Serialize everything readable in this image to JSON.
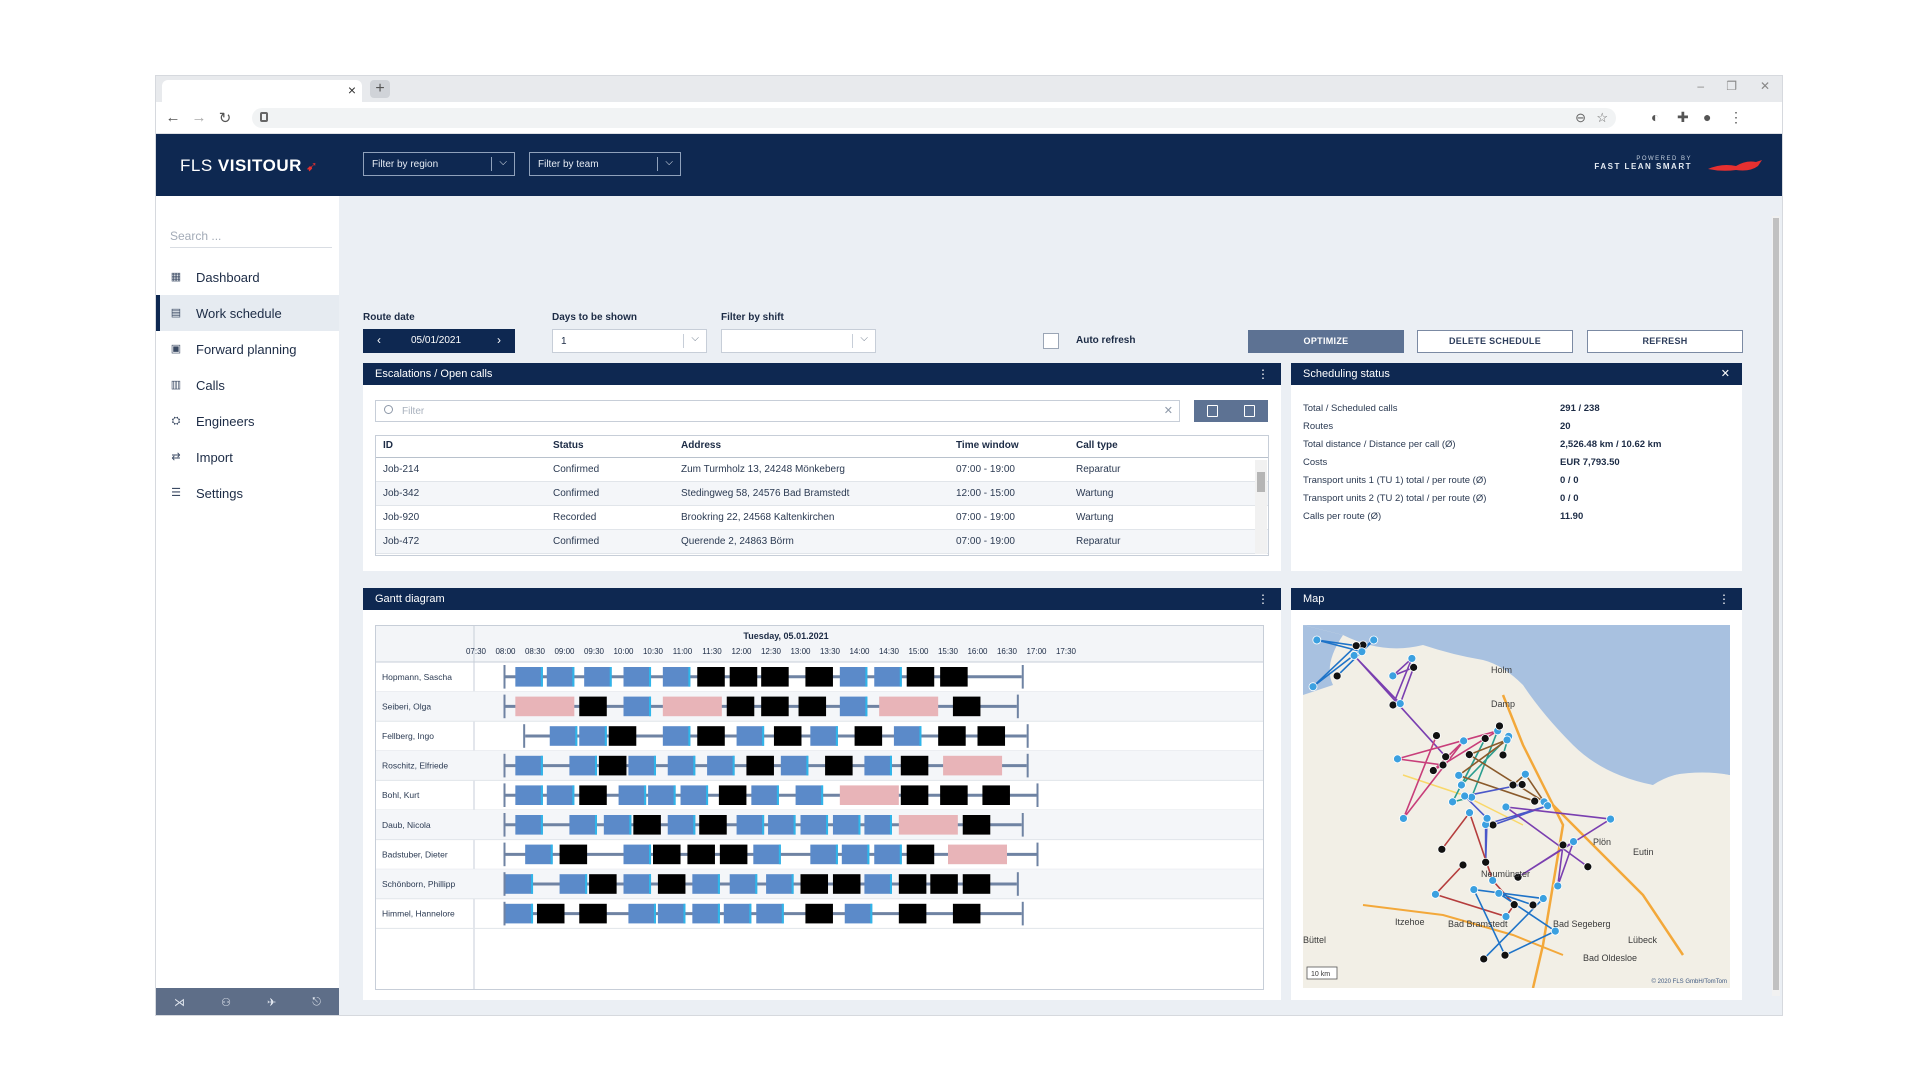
{
  "browser": {
    "newtab_label": "+",
    "close_tab": "×",
    "win_min": "–",
    "win_max": "❐",
    "win_close": "✕"
  },
  "header": {
    "logo_light": "FLS ",
    "logo_bold": "VISITOUR",
    "region_placeholder": "Filter by region",
    "team_placeholder": "Filter by team",
    "powered_by": "POWERED BY",
    "brand": "FAST LEAN SMART",
    "accent": "#e63030"
  },
  "sidebar": {
    "search_placeholder": "Search ...",
    "items": [
      {
        "label": "Dashboard",
        "icon": "dashboard-icon"
      },
      {
        "label": "Work schedule",
        "icon": "calendar-icon"
      },
      {
        "label": "Forward planning",
        "icon": "calendar-forward-icon"
      },
      {
        "label": "Calls",
        "icon": "calls-icon"
      },
      {
        "label": "Engineers",
        "icon": "engineers-icon"
      },
      {
        "label": "Import",
        "icon": "import-icon"
      },
      {
        "label": "Settings",
        "icon": "settings-icon"
      }
    ],
    "active_item": "Work schedule"
  },
  "toolbar": {
    "route_date_label": "Route date",
    "route_date": "05/01/2021",
    "days_label": "Days to be shown",
    "days_value": "1",
    "shift_label": "Filter by shift",
    "shift_value": "",
    "auto_refresh_label": "Auto refresh",
    "auto_refresh_checked": false,
    "optimize": "OPTIMIZE",
    "delete_schedule": "DELETE SCHEDULE",
    "refresh": "REFRESH"
  },
  "escalations": {
    "title": "Escalations / Open calls",
    "filter_placeholder": "Filter",
    "columns": [
      "ID",
      "Status",
      "Address",
      "Time window",
      "Call type"
    ],
    "rows": [
      [
        "Job-214",
        "Confirmed",
        "Zum Turmholz 13, 24248 Mönkeberg",
        "07:00 - 19:00",
        "Reparatur"
      ],
      [
        "Job-342",
        "Confirmed",
        "Stedingweg 58, 24576 Bad Bramstedt",
        "12:00 - 15:00",
        "Wartung"
      ],
      [
        "Job-920",
        "Recorded",
        "Brookring 22, 24568 Kaltenkirchen",
        "07:00 - 19:00",
        "Wartung"
      ],
      [
        "Job-472",
        "Confirmed",
        "Querende 2, 24863 Börm",
        "07:00 - 19:00",
        "Reparatur"
      ]
    ]
  },
  "scheduling_status": {
    "title": "Scheduling status",
    "rows": [
      {
        "label": "Total / Scheduled calls",
        "value": "291 / 238"
      },
      {
        "label": "Routes",
        "value": "20"
      },
      {
        "label": "Total distance / Distance per call (Ø)",
        "value": "2,526.48 km / 10.62 km"
      },
      {
        "label": "Costs",
        "value": "EUR 7,793.50"
      },
      {
        "label": "Transport units 1 (TU 1) total / per route (Ø)",
        "value": "0 / 0"
      },
      {
        "label": "Transport units 2 (TU 2) total / per route (Ø)",
        "value": "0 / 0"
      },
      {
        "label": "Calls per route (Ø)",
        "value": "11.90"
      }
    ]
  },
  "gantt": {
    "title": "Gantt diagram",
    "date_label": "Tuesday, 05.01.2021",
    "times": [
      "07:30",
      "08:00",
      "08:30",
      "09:00",
      "09:30",
      "10:00",
      "10:30",
      "11:00",
      "11:30",
      "12:00",
      "12:30",
      "13:00",
      "13:30",
      "14:00",
      "14:30",
      "15:00",
      "15:30",
      "16:00",
      "16:30",
      "17:00",
      "17:30"
    ],
    "colors": {
      "call": "#5b8ac9",
      "fixed": "#000000",
      "break": "#e8b4b8",
      "route": "#6f83a3",
      "overtime": "#f3c47a"
    },
    "engineers": [
      {
        "name": "Hopmann, Sascha",
        "start": "08:00",
        "end": "16:45",
        "tasks": [
          [
            "call",
            "08:10",
            "08:38"
          ],
          [
            "call",
            "08:42",
            "09:10"
          ],
          [
            "call",
            "09:20",
            "09:48"
          ],
          [
            "call",
            "10:00",
            "10:28"
          ],
          [
            "call",
            "10:40",
            "11:08"
          ],
          [
            "fixed",
            "11:15",
            "11:43"
          ],
          [
            "fixed",
            "11:48",
            "12:16"
          ],
          [
            "fixed",
            "12:20",
            "12:48"
          ],
          [
            "fixed",
            "13:05",
            "13:33"
          ],
          [
            "call",
            "13:40",
            "14:08"
          ],
          [
            "call",
            "14:15",
            "14:43"
          ],
          [
            "fixed",
            "14:48",
            "15:16"
          ],
          [
            "fixed",
            "15:22",
            "15:50"
          ]
        ]
      },
      {
        "name": "Seiberi, Olga",
        "start": "08:00",
        "end": "16:40",
        "tasks": [
          [
            "break",
            "08:10",
            "09:10"
          ],
          [
            "fixed",
            "09:15",
            "09:43"
          ],
          [
            "call",
            "10:00",
            "10:28"
          ],
          [
            "break",
            "10:40",
            "11:40"
          ],
          [
            "fixed",
            "11:45",
            "12:13"
          ],
          [
            "fixed",
            "12:20",
            "12:48"
          ],
          [
            "fixed",
            "12:58",
            "13:26"
          ],
          [
            "call",
            "13:40",
            "14:08"
          ],
          [
            "break",
            "14:20",
            "15:20"
          ],
          [
            "fixed",
            "15:35",
            "16:03"
          ]
        ]
      },
      {
        "name": "Fellberg, Ingo",
        "start": "08:20",
        "end": "16:50",
        "tasks": [
          [
            "call",
            "08:45",
            "09:13"
          ],
          [
            "call",
            "09:15",
            "09:43"
          ],
          [
            "fixed",
            "09:45",
            "10:13"
          ],
          [
            "call",
            "10:40",
            "11:08"
          ],
          [
            "fixed",
            "11:15",
            "11:43"
          ],
          [
            "call",
            "11:55",
            "12:23"
          ],
          [
            "fixed",
            "12:33",
            "13:01"
          ],
          [
            "call",
            "13:10",
            "13:38"
          ],
          [
            "fixed",
            "13:55",
            "14:23"
          ],
          [
            "call",
            "14:35",
            "15:03"
          ],
          [
            "fixed",
            "15:20",
            "15:48"
          ],
          [
            "fixed",
            "16:00",
            "16:28"
          ]
        ]
      },
      {
        "name": "Roschitz, Elfriede",
        "start": "08:00",
        "end": "16:50",
        "tasks": [
          [
            "call",
            "08:10",
            "08:38"
          ],
          [
            "call",
            "09:05",
            "09:33"
          ],
          [
            "fixed",
            "09:35",
            "10:03"
          ],
          [
            "call",
            "10:05",
            "10:33"
          ],
          [
            "call",
            "10:45",
            "11:13"
          ],
          [
            "call",
            "11:25",
            "11:53"
          ],
          [
            "fixed",
            "12:05",
            "12:33"
          ],
          [
            "call",
            "12:40",
            "13:08"
          ],
          [
            "fixed",
            "13:25",
            "13:53"
          ],
          [
            "call",
            "14:05",
            "14:33"
          ],
          [
            "fixed",
            "14:42",
            "15:10"
          ],
          [
            "break",
            "15:25",
            "16:25"
          ]
        ]
      },
      {
        "name": "Bohl, Kurt",
        "start": "08:00",
        "end": "17:00",
        "tasks": [
          [
            "call",
            "08:10",
            "08:38"
          ],
          [
            "call",
            "08:42",
            "09:10"
          ],
          [
            "fixed",
            "09:15",
            "09:43"
          ],
          [
            "call",
            "09:55",
            "10:23"
          ],
          [
            "call",
            "10:25",
            "10:53"
          ],
          [
            "call",
            "10:58",
            "11:26"
          ],
          [
            "fixed",
            "11:37",
            "12:05"
          ],
          [
            "call",
            "12:10",
            "12:38"
          ],
          [
            "call",
            "12:55",
            "13:23"
          ],
          [
            "break",
            "13:40",
            "14:40"
          ],
          [
            "fixed",
            "14:42",
            "15:10"
          ],
          [
            "fixed",
            "15:22",
            "15:50"
          ],
          [
            "fixed",
            "16:05",
            "16:33"
          ]
        ]
      },
      {
        "name": "Daub, Nicola",
        "start": "08:00",
        "end": "16:45",
        "tasks": [
          [
            "call",
            "08:10",
            "08:38"
          ],
          [
            "call",
            "09:05",
            "09:33"
          ],
          [
            "call",
            "09:40",
            "10:08"
          ],
          [
            "fixed",
            "10:10",
            "10:38"
          ],
          [
            "call",
            "10:45",
            "11:13"
          ],
          [
            "fixed",
            "11:17",
            "11:45"
          ],
          [
            "call",
            "11:55",
            "12:23"
          ],
          [
            "call",
            "12:27",
            "12:55"
          ],
          [
            "call",
            "13:00",
            "13:28"
          ],
          [
            "call",
            "13:33",
            "14:01"
          ],
          [
            "call",
            "14:05",
            "14:33"
          ],
          [
            "break",
            "14:40",
            "15:40"
          ],
          [
            "fixed",
            "15:45",
            "16:13"
          ]
        ]
      },
      {
        "name": "Badstuber, Dieter",
        "start": "08:00",
        "end": "17:00",
        "tasks": [
          [
            "call",
            "08:20",
            "08:48"
          ],
          [
            "fixed",
            "08:55",
            "09:23"
          ],
          [
            "call",
            "10:00",
            "10:28"
          ],
          [
            "fixed",
            "10:30",
            "10:58"
          ],
          [
            "fixed",
            "11:05",
            "11:33"
          ],
          [
            "fixed",
            "11:38",
            "12:06"
          ],
          [
            "call",
            "12:12",
            "12:40"
          ],
          [
            "call",
            "13:10",
            "13:38"
          ],
          [
            "call",
            "13:42",
            "14:10"
          ],
          [
            "call",
            "14:15",
            "14:43"
          ],
          [
            "fixed",
            "14:48",
            "15:16"
          ],
          [
            "break",
            "15:30",
            "16:30"
          ]
        ]
      },
      {
        "name": "Schönborn, Phillipp",
        "start": "08:00",
        "end": "16:40",
        "tasks": [
          [
            "call",
            "08:00",
            "08:28"
          ],
          [
            "call",
            "08:55",
            "09:23"
          ],
          [
            "fixed",
            "09:25",
            "09:53"
          ],
          [
            "call",
            "10:00",
            "10:28"
          ],
          [
            "fixed",
            "10:35",
            "11:03"
          ],
          [
            "call",
            "11:10",
            "11:38"
          ],
          [
            "call",
            "11:48",
            "12:16"
          ],
          [
            "call",
            "12:25",
            "12:53"
          ],
          [
            "fixed",
            "13:00",
            "13:28"
          ],
          [
            "fixed",
            "13:33",
            "14:01"
          ],
          [
            "call",
            "14:05",
            "14:33"
          ],
          [
            "fixed",
            "14:40",
            "15:08"
          ],
          [
            "fixed",
            "15:12",
            "15:40"
          ],
          [
            "fixed",
            "15:45",
            "16:13"
          ]
        ]
      },
      {
        "name": "Himmel, Hannelore",
        "start": "08:00",
        "end": "16:45",
        "tasks": [
          [
            "call",
            "08:00",
            "08:28"
          ],
          [
            "fixed",
            "08:32",
            "09:00"
          ],
          [
            "fixed",
            "09:15",
            "09:43"
          ],
          [
            "call",
            "10:05",
            "10:33"
          ],
          [
            "call",
            "10:35",
            "11:03"
          ],
          [
            "call",
            "11:10",
            "11:38"
          ],
          [
            "call",
            "11:42",
            "12:10"
          ],
          [
            "call",
            "12:15",
            "12:43"
          ],
          [
            "fixed",
            "13:05",
            "13:33"
          ],
          [
            "call",
            "13:45",
            "14:13"
          ],
          [
            "fixed",
            "14:40",
            "15:08"
          ],
          [
            "fixed",
            "15:35",
            "16:03"
          ]
        ]
      }
    ]
  },
  "map": {
    "title": "Map",
    "labels": [
      "Holm",
      "Damp",
      "Eutin",
      "Plön",
      "Neumünster",
      "Itzehoe",
      "Bad Bramstedt",
      "Bad Segeberg",
      "Lübeck",
      "Bad Oldesloe",
      "Büttel"
    ],
    "scale": "10 km",
    "copyright": "© 2020 FLS GmbH/TomTom"
  }
}
